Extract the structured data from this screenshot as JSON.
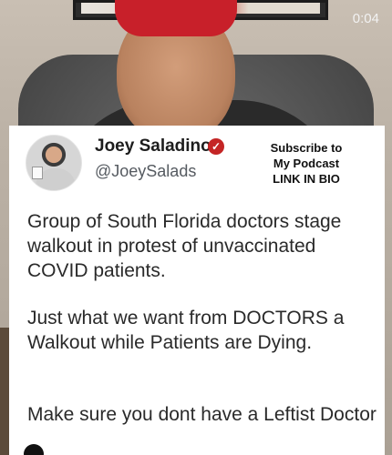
{
  "video": {
    "timestamp": "0:04"
  },
  "tweet": {
    "author_name": "Joey Saladino",
    "verified_mark": "✓",
    "handle": "@JoeySalads",
    "promo": {
      "line1": "Subscribe to",
      "line2": "My Podcast",
      "line3": "LINK IN BIO"
    },
    "paragraphs": [
      "Group of South Florida doctors stage walkout in protest of unvaccinated COVID patients.",
      "Just what we want from DOCTORS a Walkout while Patients are Dying.",
      "Make sure you dont have a Leftist Doctor"
    ]
  },
  "colors": {
    "verified_badge": "#c42525",
    "card_background": "#ffffff",
    "text": "#2a2a2a"
  }
}
